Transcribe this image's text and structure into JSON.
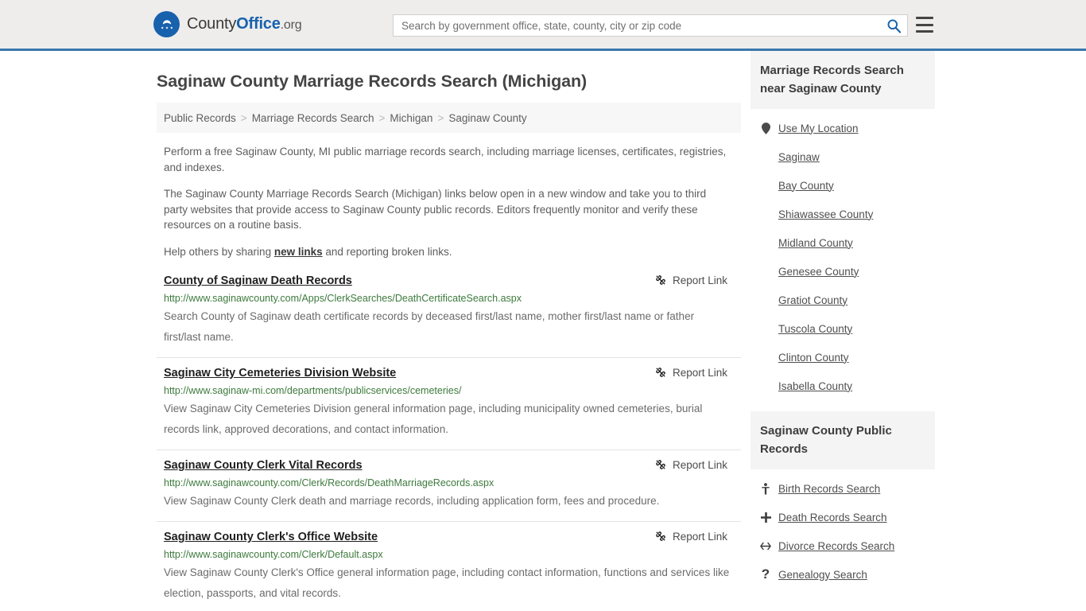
{
  "header": {
    "logo": {
      "part1": "County",
      "part2": "Office",
      "part3": ".org",
      "icon": "eagle-seal-logo"
    },
    "search": {
      "placeholder": "Search by government office, state, county, city or zip code",
      "value": "",
      "button_icon": "search-icon"
    },
    "menu_icon": "hamburger-menu-icon",
    "accent_color": "#3b77ab",
    "background_color": "#eeedec"
  },
  "page": {
    "title": "Saginaw County Marriage Records Search (Michigan)"
  },
  "breadcrumb": {
    "separator": ">",
    "items": [
      {
        "label": "Public Records"
      },
      {
        "label": "Marriage Records Search"
      },
      {
        "label": "Michigan"
      },
      {
        "label": "Saginaw County"
      }
    ]
  },
  "intro": {
    "p1": "Perform a free Saginaw County, MI public marriage records search, including marriage licenses, certificates, registries, and indexes.",
    "p2": "The Saginaw County Marriage Records Search (Michigan) links below open in a new window and take you to third party websites that provide access to Saginaw County public records. Editors frequently monitor and verify these resources on a routine basis.",
    "p3_before": "Help others by sharing ",
    "p3_link": "new links",
    "p3_after": " and reporting broken links."
  },
  "results": {
    "report_label": "Report Link",
    "report_icon": "broken-link-icon",
    "items": [
      {
        "title": "County of Saginaw Death Records",
        "url": "http://www.saginawcounty.com/Apps/ClerkSearches/DeathCertificateSearch.aspx",
        "description": "Search County of Saginaw death certificate records by deceased first/last name, mother first/last name or father first/last name."
      },
      {
        "title": "Saginaw City Cemeteries Division Website",
        "url": "http://www.saginaw-mi.com/departments/publicservices/cemeteries/",
        "description": "View Saginaw City Cemeteries Division general information page, including municipality owned cemeteries, burial records link, approved decorations, and contact information."
      },
      {
        "title": "Saginaw County Clerk Vital Records",
        "url": "http://www.saginawcounty.com/Clerk/Records/DeathMarriageRecords.aspx",
        "description": "View Saginaw County Clerk death and marriage records, including application form, fees and procedure."
      },
      {
        "title": "Saginaw County Clerk's Office Website",
        "url": "http://www.saginawcounty.com/Clerk/Default.aspx",
        "description": "View Saginaw County Clerk's Office general information page, including contact information, functions and services like election, passports, and vital records."
      }
    ]
  },
  "sidebar": {
    "nearby": {
      "heading": "Marriage Records Search near Saginaw County",
      "items": [
        {
          "label": "Use My Location",
          "icon": "map-pin-icon"
        },
        {
          "label": "Saginaw",
          "icon": ""
        },
        {
          "label": "Bay County",
          "icon": ""
        },
        {
          "label": "Shiawassee County",
          "icon": ""
        },
        {
          "label": "Midland County",
          "icon": ""
        },
        {
          "label": "Genesee County",
          "icon": ""
        },
        {
          "label": "Gratiot County",
          "icon": ""
        },
        {
          "label": "Tuscola County",
          "icon": ""
        },
        {
          "label": "Clinton County",
          "icon": ""
        },
        {
          "label": "Isabella County",
          "icon": ""
        }
      ]
    },
    "public_records": {
      "heading": "Saginaw County Public Records",
      "items": [
        {
          "label": "Birth Records Search",
          "icon": "baby-icon"
        },
        {
          "label": "Death Records Search",
          "icon": "cross-plus-icon"
        },
        {
          "label": "Divorce Records Search",
          "icon": "left-right-arrow-icon"
        },
        {
          "label": "Genealogy Search",
          "icon": "question-mark-icon"
        }
      ]
    }
  }
}
